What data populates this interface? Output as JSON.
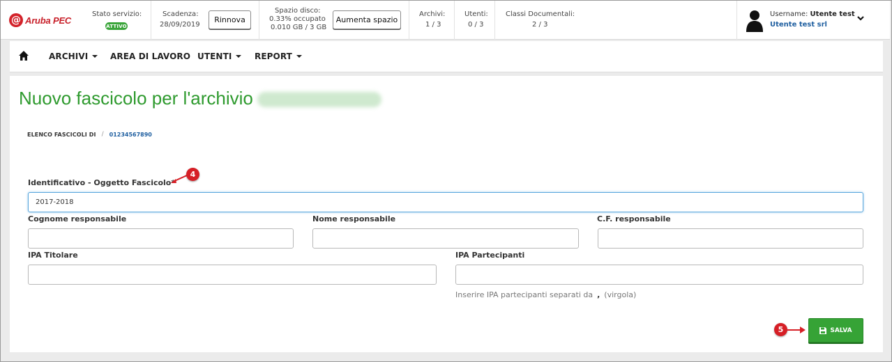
{
  "brand": {
    "logo_text": "Aruba PEC",
    "logo_glyph": "@"
  },
  "topbar": {
    "service_status_label": "Stato servizio:",
    "service_status_badge": "ATTIVO",
    "expiry_label": "Scadenza:",
    "expiry_date": "28/09/2019",
    "renew_button": "Rinnova",
    "disk_label": "Spazio disco:",
    "disk_percent": "0.33% occupato",
    "disk_usage": "0.010 GB / 3 GB",
    "increase_space_button": "Aumenta spazio",
    "archives_label": "Archivi:",
    "archives_value": "1 / 3",
    "users_label": "Utenti:",
    "users_value": "0 / 3",
    "doc_classes_label": "Classi Documentali:",
    "doc_classes_value": "2 / 3",
    "username_label": "Username:",
    "username_value": "Utente test",
    "organization": "Utente test srl"
  },
  "nav": {
    "home_icon": "home-icon",
    "items": [
      {
        "label": "ARCHIVI",
        "dropdown": true
      },
      {
        "label": "AREA DI LAVORO",
        "dropdown": false
      },
      {
        "label": "UTENTI",
        "dropdown": true
      },
      {
        "label": "REPORT",
        "dropdown": true
      }
    ]
  },
  "page": {
    "title": "Nuovo fascicolo per l'archivio",
    "breadcrumb": {
      "parent": "ELENCO FASCICOLI DI",
      "current": "01234567890"
    }
  },
  "form": {
    "identifier_label": "Identificativo - Oggetto Fascicolo*",
    "identifier_value": "2017-2018",
    "surname_label": "Cognome responsabile",
    "surname_value": "",
    "name_label": "Nome responsabile",
    "name_value": "",
    "cf_label": "C.F. responsabile",
    "cf_value": "",
    "ipa_holder_label": "IPA Titolare",
    "ipa_holder_value": "",
    "ipa_participants_label": "IPA Partecipanti",
    "ipa_participants_value": "",
    "hint_text": "Inserire IPA partecipanti separati da",
    "hint_comma": ",",
    "hint_suffix": "(virgola)",
    "save_button": "SALVA"
  },
  "annotations": {
    "step_4": "4",
    "step_5": "5"
  },
  "colors": {
    "brand_red": "#d3222a",
    "title_green": "#2e9a2e",
    "save_green": "#36a336",
    "link_blue": "#1f5fa0",
    "annotation_red": "#d61f26"
  }
}
